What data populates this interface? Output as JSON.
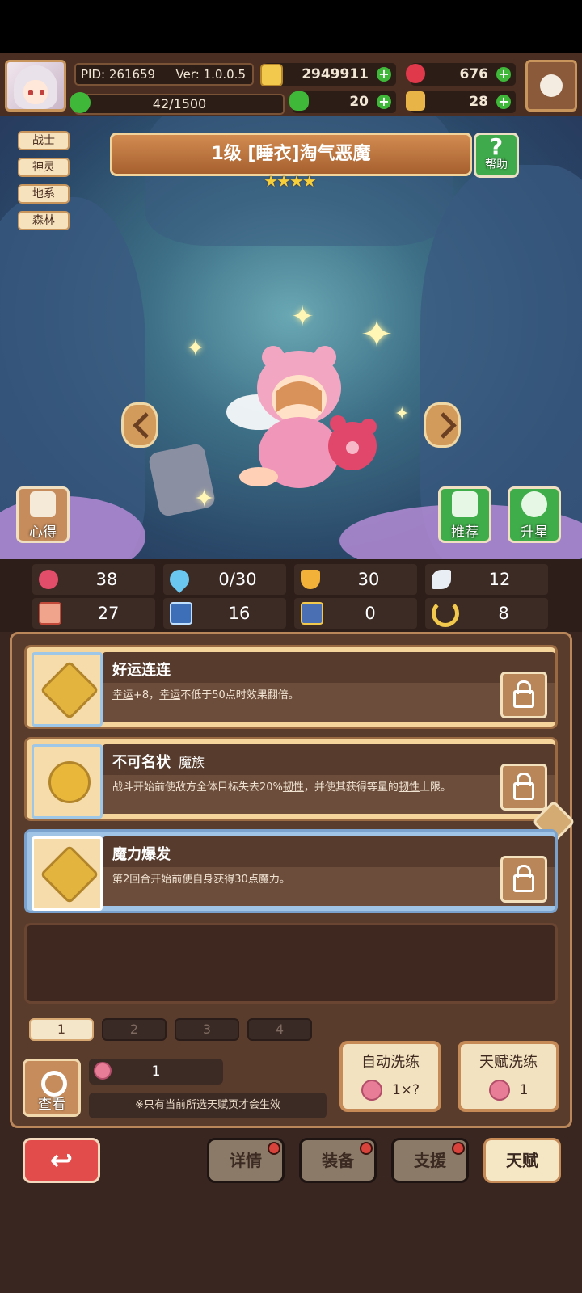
{
  "header": {
    "pid": "PID: 261659",
    "version": "Ver: 1.0.0.5",
    "coins": "2949911",
    "gems": "676",
    "clovers": "20",
    "keys": "28",
    "exp": "42/1500",
    "exp_fraction": 0.028
  },
  "tags": [
    "战士",
    "神灵",
    "地系",
    "森林"
  ],
  "hero": {
    "title": "1级  [睡衣]淘气恶魔",
    "stars": "★★★★",
    "help_label": "帮助",
    "left_button_label": "心得",
    "recommend_label": "推荐",
    "star_up_label": "升星"
  },
  "stats": [
    {
      "icon": "heart-icon",
      "value": "38"
    },
    {
      "icon": "drop-icon",
      "value": "0/30"
    },
    {
      "icon": "shield-icon",
      "value": "30"
    },
    {
      "icon": "wing-icon",
      "value": "12"
    },
    {
      "icon": "fist-icon",
      "value": "27"
    },
    {
      "icon": "book-icon",
      "value": "16"
    },
    {
      "icon": "boot-icon",
      "value": "0"
    },
    {
      "icon": "horseshoe-icon",
      "value": "8"
    }
  ],
  "talents": [
    {
      "name": "好运连连",
      "sub": "",
      "desc_a": "幸运",
      "desc_b": "+8，",
      "desc_c": "幸运",
      "desc_d": "不低于50点时效果翻倍。",
      "desc_e": ""
    },
    {
      "name": "不可名状",
      "sub": "魔族",
      "desc_a": "战斗开始前使敌方全体目标失去20%",
      "desc_b": "韧性",
      "desc_c": "，并使其获得等量的",
      "desc_d": "韧性",
      "desc_e": "上限。"
    },
    {
      "name": "魔力爆发",
      "sub": "",
      "desc_a": "第2回合开始前使自身获得30点魔力。",
      "desc_b": "",
      "desc_c": "",
      "desc_d": "",
      "desc_e": ""
    }
  ],
  "pages": [
    "1",
    "2",
    "3",
    "4"
  ],
  "bottom_panel": {
    "view_label": "查看",
    "berry_count": "1",
    "note": "※只有当前所选天赋页才会生效",
    "auto_refine_label": "自动洗练",
    "auto_refine_cost": "1×?",
    "talent_refine_label": "天赋洗练",
    "talent_refine_cost": "1"
  },
  "nav": {
    "details": "详情",
    "equipment": "装备",
    "support": "支援",
    "talent": "天赋"
  },
  "colors": {
    "accent_gold": "#f7cf3a",
    "green_plus": "#3fb83a",
    "red_back": "#e24d4b",
    "panel_brown": "#5a3c2c"
  }
}
